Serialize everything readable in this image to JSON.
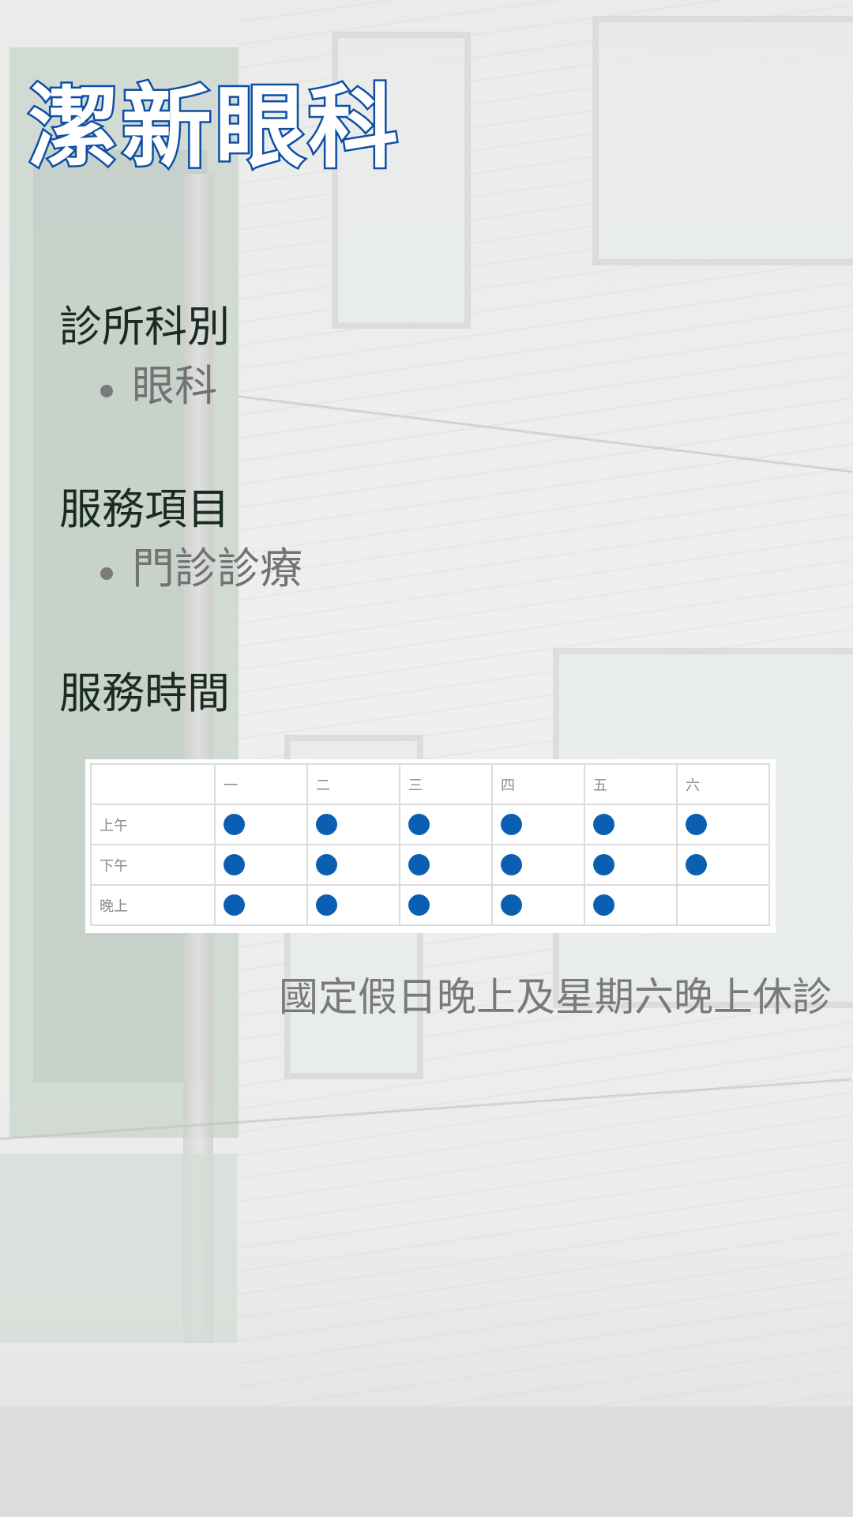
{
  "logo": {
    "text": "潔新眼科"
  },
  "sections": [
    {
      "heading": "診所科別",
      "items": [
        "眼科"
      ]
    },
    {
      "heading": "服務項目",
      "items": [
        "門診診療"
      ]
    },
    {
      "heading": "服務時間"
    }
  ],
  "schedule": {
    "days": [
      "一",
      "二",
      "三",
      "四",
      "五",
      "六"
    ],
    "rows": [
      {
        "label": "上午",
        "open": [
          true,
          true,
          true,
          true,
          true,
          true
        ]
      },
      {
        "label": "下午",
        "open": [
          true,
          true,
          true,
          true,
          true,
          true
        ]
      },
      {
        "label": "晚上",
        "open": [
          true,
          true,
          true,
          true,
          true,
          false
        ]
      }
    ],
    "dot_color": "#0b5fb3"
  },
  "note": "國定假日晚上及星期六晚上休診"
}
